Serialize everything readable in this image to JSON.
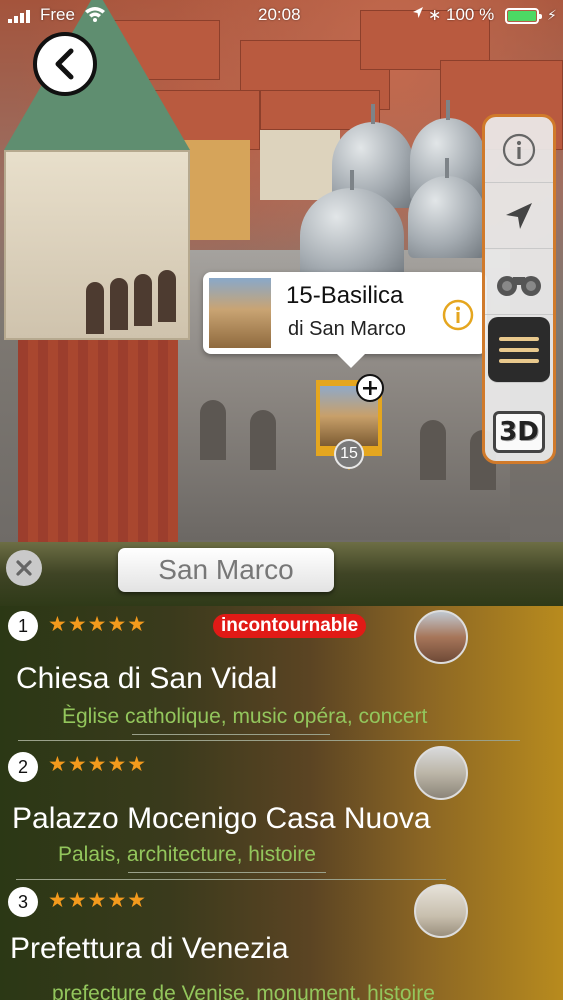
{
  "status_bar": {
    "carrier": "Free",
    "time": "20:08",
    "battery": "100 %"
  },
  "map": {
    "poi": {
      "title": "15-Basilica",
      "subtitle": "di San Marco",
      "marker_number": "15"
    },
    "toolbar": {
      "three_d_label": "3D"
    }
  },
  "list": {
    "area_title": "San Marco",
    "items": [
      {
        "rank": "1",
        "stars": "★★★★★",
        "badge": "incontournable",
        "name": "Chiesa di San Vidal",
        "tags": "Ègliѕe catholique, music opéra, concert"
      },
      {
        "rank": "2",
        "stars": "★★★★★",
        "name": "Palazzo Mocenigo Casa Nuova",
        "tags": "Palais, architecture, histoire"
      },
      {
        "rank": "3",
        "stars": "★★★★★",
        "name": "Prefettura di Venezia",
        "tags": "prefecture de Venise, monument, histoire"
      }
    ]
  },
  "colors": {
    "accent_orange": "#d07a2b",
    "star": "#f39a1d",
    "badge_red": "#e11a16",
    "tag_green": "#93c65c"
  },
  "icons": [
    "back-arrow-icon",
    "info-icon",
    "navigation-arrow-icon",
    "binoculars-icon",
    "menu-icon",
    "plus-icon",
    "close-icon"
  ]
}
